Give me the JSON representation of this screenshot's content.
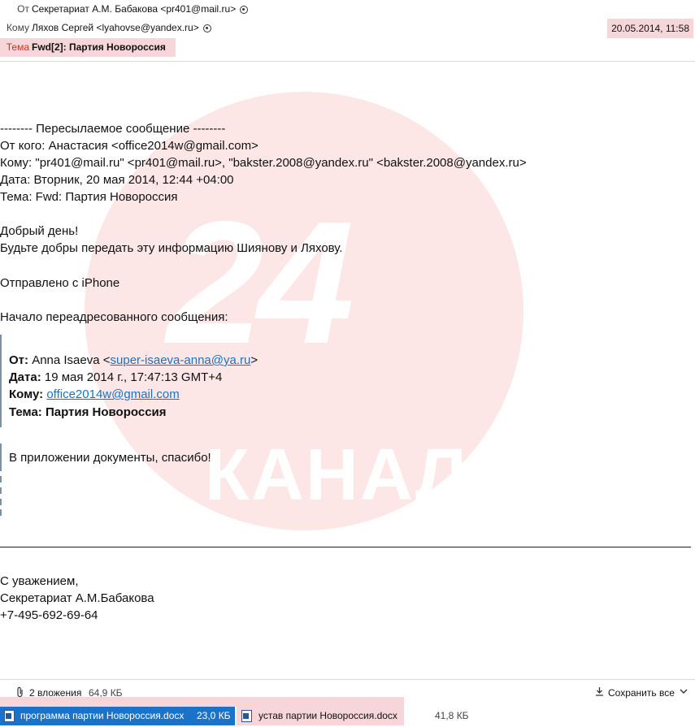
{
  "header": {
    "from_label": "От",
    "from_value": "Секретариат А.М. Бабакова <pr401@mail.ru>",
    "to_label": "Кому",
    "to_value": "Ляхов Сергей <lyahovse@yandex.ru>",
    "subject_label": "Тема",
    "subject_value": "Fwd[2]: Партия Новороссия",
    "date": "20.05.2014, 11:58"
  },
  "body": {
    "fwd_header": "-------- Пересылаемое сообщение --------",
    "fwd_from": "От кого: Анастасия <office2014w@gmail.com>",
    "fwd_to": "Кому: \"pr401@mail.ru\" <pr401@mail.ru>, \"bakster.2008@yandex.ru\" <bakster.2008@yandex.ru>",
    "fwd_date": "Дата: Вторник, 20 мая 2014, 12:44 +04:00",
    "fwd_subject": "Тема: Fwd: Партия Новороссия",
    "greeting": "Добрый день!",
    "request": "Будьте добры передать эту информацию Шиянову и Ляхову.",
    "sent_from": "Отправлено с iPhone",
    "forward_start": "Начало переадресованного сообщения:",
    "quoted": {
      "from_label": "От:",
      "from_name": "Anna Isaeva <",
      "from_email": "super-isaeva-anna@ya.ru",
      "from_tail": ">",
      "date_label": "Дата:",
      "date_value": "19 мая 2014 г., 17:47:13 GMT+4",
      "to_label": "Кому:",
      "to_email": "office2014w@gmail.com",
      "subject_label": "Тема: Партия Новороссия",
      "message": "В приложении документы, спасибо!"
    },
    "signature": {
      "line1": "С уважением,",
      "line2": "Секретариат А.М.Бабакова",
      "line3": "+7-495-692-69-64"
    }
  },
  "watermark": {
    "number": "24",
    "word": "КАНАЛ"
  },
  "attachments_bar": {
    "count_label": "2 вложения",
    "total_size": "64,9 КБ",
    "save_all_label": "Сохранить все",
    "items": [
      {
        "name": "программа партии Новороссия.docx",
        "size": "23,0 КБ"
      },
      {
        "name": "устав партии Новороссия.docx",
        "size": "41,8 КБ"
      }
    ]
  },
  "colors": {
    "accent": "#1a73c8",
    "highlight": "#f6d6d8",
    "watermark": "#fad2d2"
  }
}
